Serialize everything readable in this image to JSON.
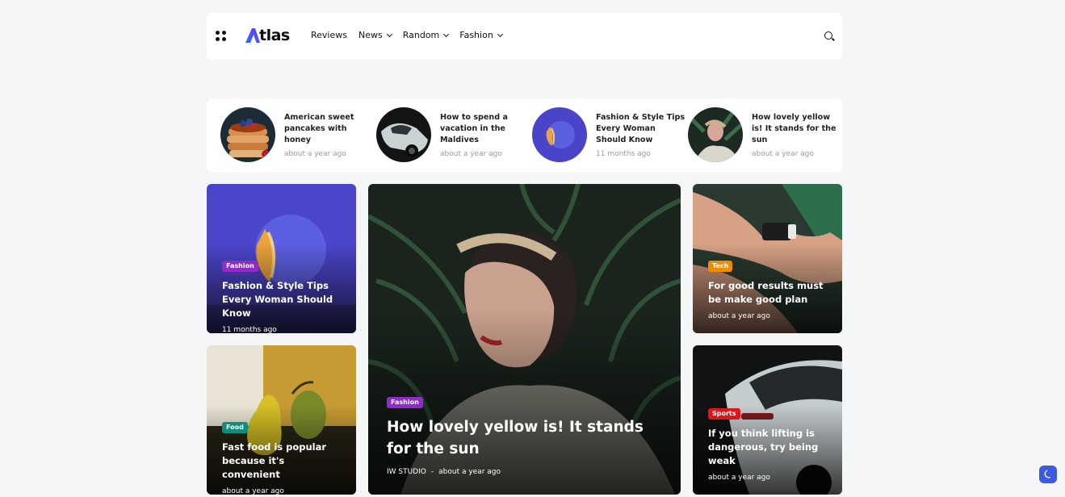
{
  "header": {
    "logo_text": "tlas",
    "nav": [
      {
        "label": "Reviews"
      },
      {
        "label": "News"
      },
      {
        "label": "Random"
      },
      {
        "label": "Fashion"
      }
    ]
  },
  "trending": [
    {
      "title": "American sweet pancakes with honey",
      "time": "about a year ago"
    },
    {
      "title": "How to spend a vacation in the Maldives",
      "time": "about a year ago"
    },
    {
      "title": "Fashion & Style Tips Every Woman Should Know",
      "time": "11 months ago"
    },
    {
      "title": "How lovely yellow is! It stands for the sun",
      "time": "about a year ago"
    }
  ],
  "cards": {
    "fashion_tips": {
      "badge": "Fashion",
      "title": "Fashion & Style Tips Every Woman Should Know",
      "time": "11 months ago",
      "badge_color": "#8e2bc9"
    },
    "fast_food": {
      "badge": "Food",
      "title": "Fast food is popular because it's convenient",
      "time": "about a year ago",
      "badge_color": "#0e8f7e"
    },
    "featured": {
      "badge": "Fashion",
      "title": "How lovely yellow is! It stands for the sun",
      "author": "IW STUDIO",
      "separator": "-",
      "time": "about a year ago",
      "badge_color": "#8e2bc9"
    },
    "good_results": {
      "badge": "Tech",
      "title": "For good results must be make good plan",
      "time": "about a year ago",
      "badge_color": "#f08c00"
    },
    "lifting": {
      "badge": "Sports",
      "title": "If you think lifting is dangerous, try being weak",
      "time": "about a year ago",
      "badge_color": "#e0151c"
    }
  },
  "colors": {
    "accent": "#3b5bdb"
  },
  "icons": [
    "menu-grid-icon",
    "search-icon",
    "chevron-down-icon",
    "moon-icon"
  ]
}
